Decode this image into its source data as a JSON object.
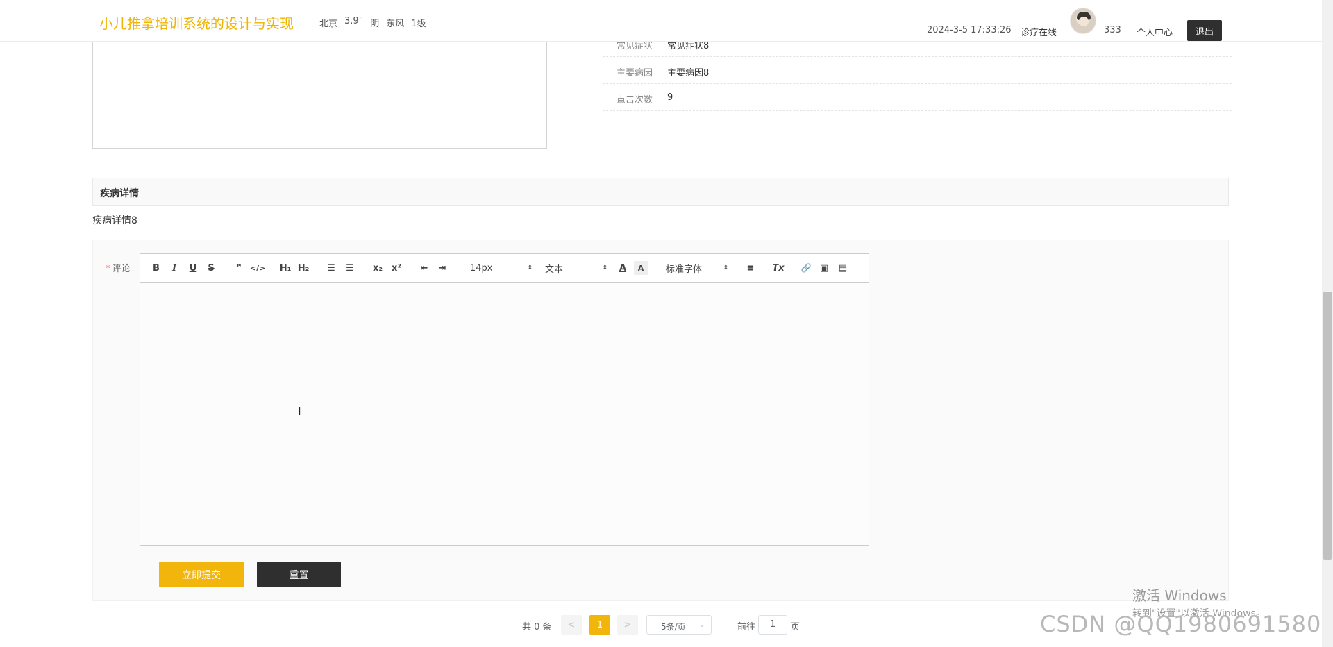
{
  "header": {
    "site_title": "小儿推拿培训系统的设计与实现",
    "weather": {
      "city": "北京",
      "temp": "3.9°",
      "condition": "阴",
      "wind": "东风",
      "level": "1级"
    },
    "datetime": "2024-3-5 17:33:26",
    "nav_diagnosis": "诊疗在线",
    "username": "333",
    "nav_profile": "个人中心",
    "logout_label": "退出"
  },
  "details": {
    "rows": [
      {
        "key": "常见症状",
        "value": "常见症状8"
      },
      {
        "key": "主要病因",
        "value": "主要病因8"
      },
      {
        "key": "点击次数",
        "value": "9"
      }
    ]
  },
  "disease": {
    "section_title": "疾病详情",
    "content": "疾病详情8"
  },
  "comment_form": {
    "required_mark": "*",
    "label": "评论",
    "toolbar": {
      "bold": "B",
      "italic": "I",
      "underline": "U",
      "strike": "S",
      "blockquote": "❞",
      "code": "</>",
      "h1": "H₁",
      "h2": "H₂",
      "ordered_list": "☰",
      "bullet_list": "☰",
      "subscript": "x₂",
      "superscript": "x²",
      "outdent": "⇤",
      "indent": "⇥",
      "size_value": "14px",
      "header_value": "文本",
      "color": "A",
      "background": "A",
      "font_value": "标准字体",
      "align": "≡",
      "clean": "Tx",
      "link": "🔗",
      "image": "▣",
      "video": "▤"
    },
    "cursor": "I",
    "submit_label": "立即提交",
    "reset_label": "重置"
  },
  "pagination": {
    "total_text": "共 0 条",
    "prev": "<",
    "current_page": "1",
    "next": ">",
    "page_size": "5条/页",
    "goto_label": "前往",
    "goto_value": "1",
    "goto_unit": "页"
  },
  "overlays": {
    "activate_title": "激活 Windows",
    "activate_sub": "转到\"设置\"以激活 Windows。",
    "watermark": "CSDN @QQ1980691580"
  },
  "colors": {
    "accent": "#f2b50c",
    "dark_button": "#2f2f2f",
    "title": "#f0b400"
  }
}
